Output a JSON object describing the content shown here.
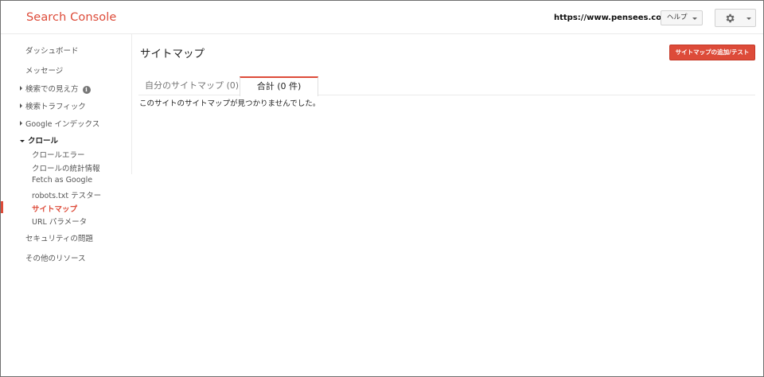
{
  "header": {
    "logo": "Search Console",
    "site_url": "https://www.pensees.co.jp/",
    "help_label": "ヘルプ",
    "settings_icon": "gear-icon"
  },
  "sidebar": {
    "items": [
      {
        "label": "ダッシュボード"
      },
      {
        "label": "メッセージ"
      },
      {
        "label": "検索での見え方",
        "info_icon": "i"
      },
      {
        "label": "検索トラフィック"
      },
      {
        "label": "Google インデックス"
      },
      {
        "label": "クロール"
      },
      {
        "label": "セキュリティの問題"
      },
      {
        "label": "その他のリソース"
      }
    ],
    "crawl_subitems": [
      {
        "label": "クロールエラー"
      },
      {
        "label": "クロールの統計情報"
      },
      {
        "label": "Fetch as Google"
      },
      {
        "label": "robots.txt テスター"
      },
      {
        "label": "サイトマップ",
        "active": true
      },
      {
        "label": "URL パラメータ"
      }
    ]
  },
  "main": {
    "title": "サイトマップ",
    "add_button_label": "サイトマップの追加/テスト",
    "tabs": [
      {
        "label": "自分のサイトマップ (0)",
        "active": false
      },
      {
        "label": "合計 (0 件)",
        "active": true
      }
    ],
    "empty_message": "このサイトのサイトマップが見つかりませんでした。"
  },
  "colors": {
    "brand_red": "#dd4b39"
  }
}
